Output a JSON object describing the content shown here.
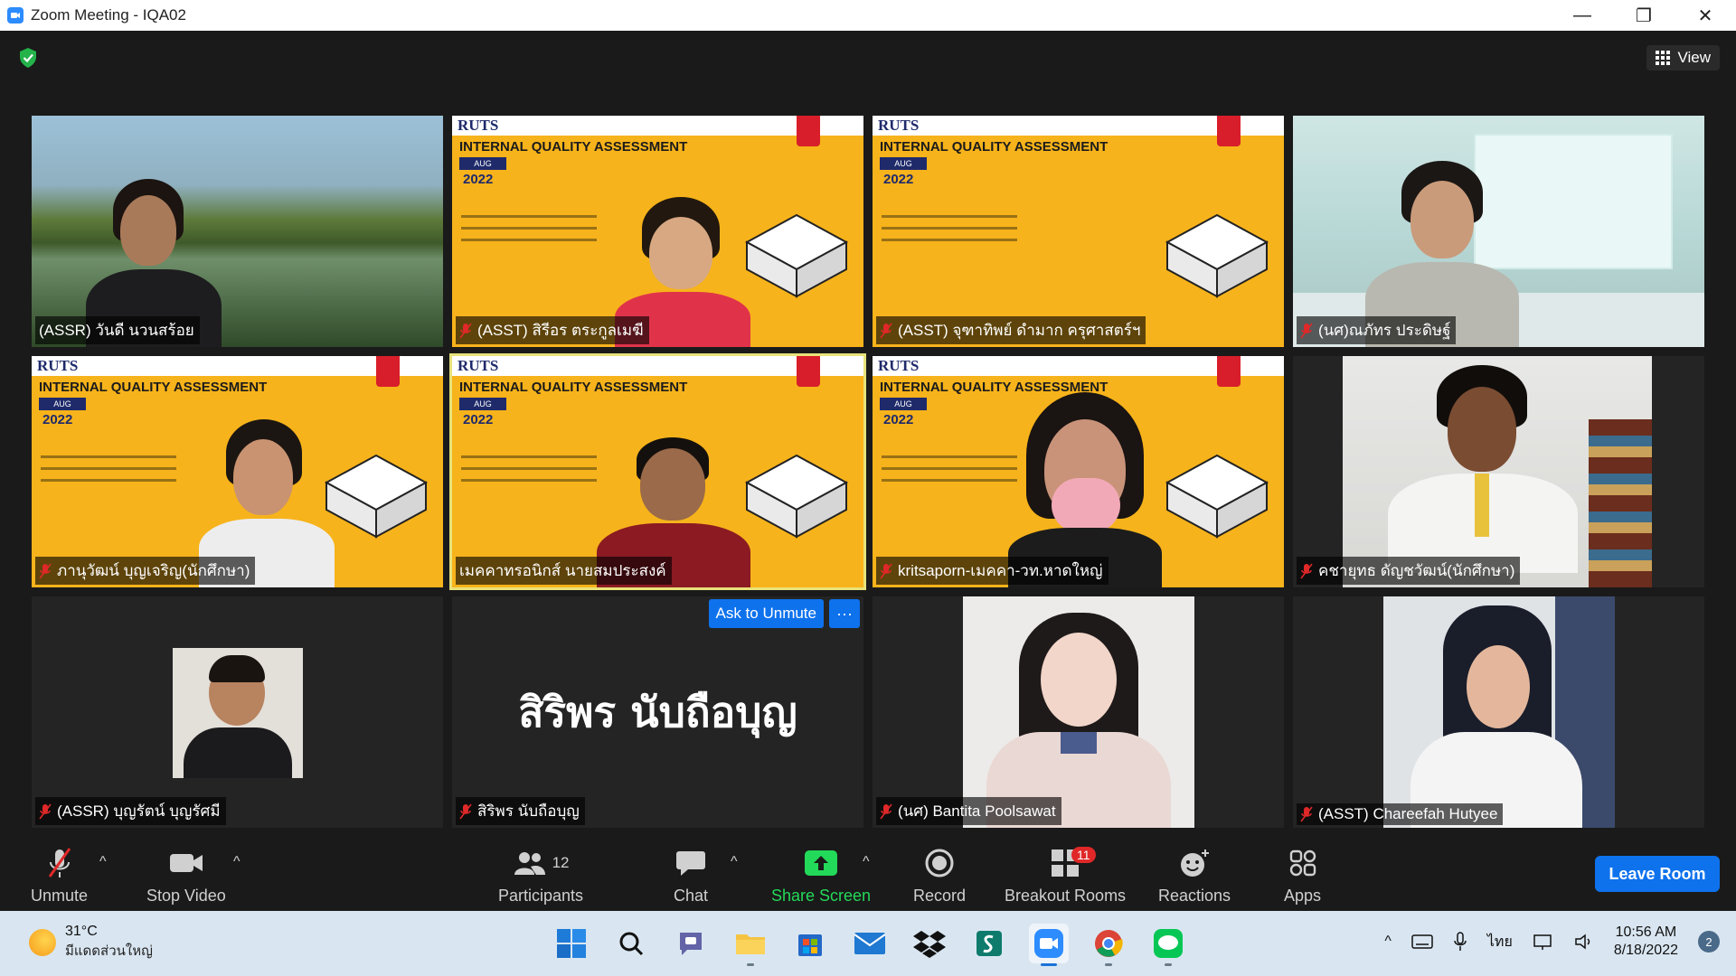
{
  "window": {
    "title": "Zoom Meeting - IQA02"
  },
  "meeting": {
    "view_label": "View"
  },
  "slide": {
    "brand": "RUTS",
    "title": "INTERNAL QUALITY ASSESSMENT",
    "month": "AUG",
    "year": "2022"
  },
  "tiles": [
    {
      "name": "(ASSR) วันดี นวนสร้อย",
      "muted": false
    },
    {
      "name": "(ASST) สิรีอร ตระกูลเมฆี",
      "muted": true
    },
    {
      "name": "(ASST) จุฑาทิพย์ ดำมาก ครุศาสตร์ฯ",
      "muted": true
    },
    {
      "name": "(นศ)ณภัทร ประดิษฐ์",
      "muted": true
    },
    {
      "name": "ภานุวัฒน์ บุญเจริญ(นักศึกษา)",
      "muted": true
    },
    {
      "name": "เมคคาทรอนิกส์ นายสมประสงค์",
      "muted": false
    },
    {
      "name": "kritsaporn-เมคคา-วท.หาดใหญ่",
      "muted": true
    },
    {
      "name": "คชายุทธ ดัญชวัฒน์(นักศึกษา)",
      "muted": true
    },
    {
      "name": "(ASSR) บุญรัตน์ บุญรัศมี",
      "muted": true
    },
    {
      "name": "สิริพร นับถือบุญ",
      "muted": true,
      "big_name": "สิริพร นับถือบุญ",
      "ask_unmute": "Ask to Unmute",
      "more": "···"
    },
    {
      "name": "(นศ) Bantita Poolsawat",
      "muted": true
    },
    {
      "name": "(ASST) Chareefah Hutyee",
      "muted": true
    }
  ],
  "toolbar": {
    "unmute": "Unmute",
    "stop_video": "Stop Video",
    "participants": "Participants",
    "participants_count": "12",
    "chat": "Chat",
    "share_screen": "Share Screen",
    "record": "Record",
    "breakout_rooms": "Breakout Rooms",
    "breakout_badge": "11",
    "reactions": "Reactions",
    "apps": "Apps",
    "leave": "Leave Room"
  },
  "taskbar": {
    "temperature": "31°C",
    "weather": "มีแดดส่วนใหญ่",
    "language": "ไทย",
    "time": "10:56 AM",
    "date": "8/18/2022",
    "notifications": "2"
  },
  "colors": {
    "zoom_blue": "#0e72ed",
    "share_green": "#23d959",
    "slide_yellow": "#f7b31b",
    "muted_red": "#e02828"
  }
}
